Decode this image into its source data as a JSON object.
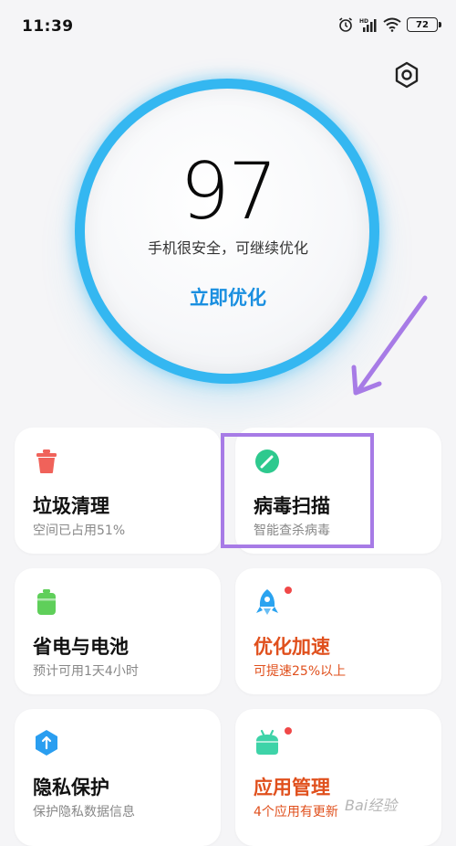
{
  "status_bar": {
    "time": "11:39",
    "battery": "72"
  },
  "score_panel": {
    "score": "97",
    "status": "手机很安全，可继续优化",
    "action": "立即优化",
    "ring_color": "#34b7f1"
  },
  "cards": [
    {
      "title": "垃圾清理",
      "subtitle": "空间已占用51%",
      "icon": "trash-icon",
      "color": "#f0625a"
    },
    {
      "title": "病毒扫描",
      "subtitle": "智能查杀病毒",
      "icon": "shield-scan-icon",
      "color": "#2ec98e"
    },
    {
      "title": "省电与电池",
      "subtitle": "预计可用1天4小时",
      "icon": "battery-icon",
      "color": "#5fcf5a"
    },
    {
      "title": "优化加速",
      "subtitle": "可提速25%以上",
      "icon": "rocket-icon",
      "color": "#2aa3f0",
      "highlight": "#e0501d"
    },
    {
      "title": "隐私保护",
      "subtitle": "保护隐私数据信息",
      "icon": "privacy-icon",
      "color": "#2a9ef0"
    },
    {
      "title": "应用管理",
      "subtitle": "4个应用有更新",
      "icon": "app-icon",
      "color": "#3ed3a8",
      "highlight": "#e0501d"
    }
  ],
  "annotation": {
    "color": "#a77be6"
  },
  "watermark": "Bai经验"
}
